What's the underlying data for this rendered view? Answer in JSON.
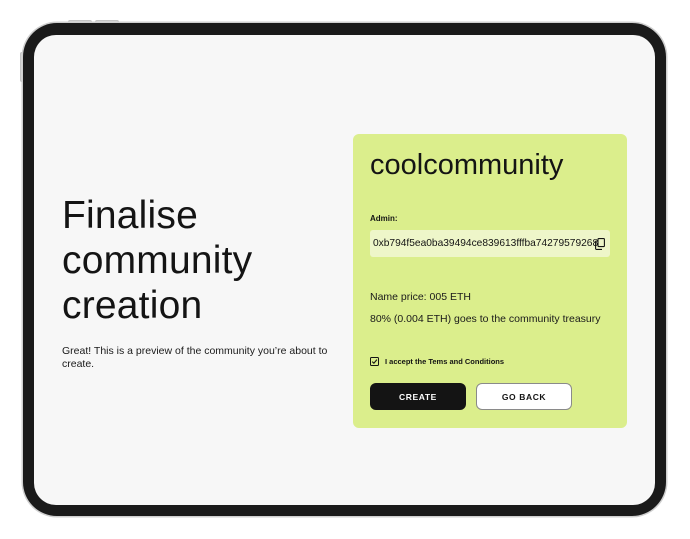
{
  "page": {
    "heading": "Finalise community creation",
    "subtitle": "Great! This is a preview of the community you’re about to create."
  },
  "card": {
    "community_name": "coolcommunity",
    "admin_label": "Admin:",
    "admin_address": "0xb794f5ea0ba39494ce839613fffba74279579268",
    "name_price": "Name price: 005 ETH",
    "treasury_note": "80% (0.004 ETH) goes to the community treasury",
    "terms_label": "I accept the Tems and Conditions",
    "terms_checked": true,
    "create_label": "CREATE",
    "back_label": "GO BACK"
  },
  "icons": {
    "copy": "copy-icon",
    "checkbox": "check-icon"
  },
  "colors": {
    "card_background": "#dbee8c",
    "address_background": "#eef6c9",
    "primary_button": "#141414",
    "screen_background": "#f7f7f7",
    "device_bezel": "#1a1a1a"
  }
}
